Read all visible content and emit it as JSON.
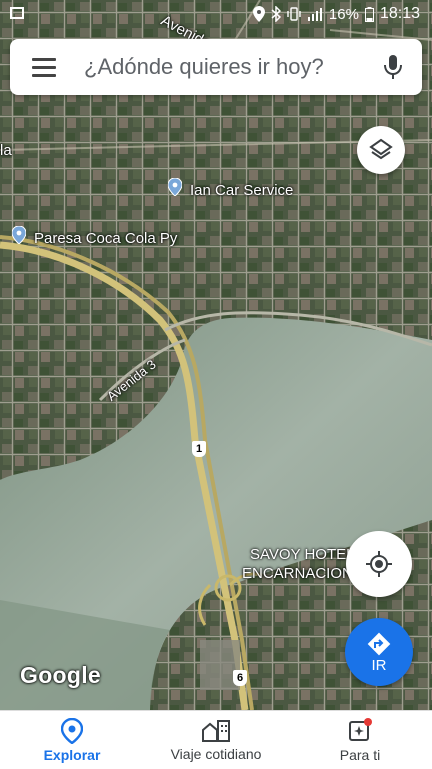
{
  "status": {
    "battery": "16%",
    "time": "18:13"
  },
  "search": {
    "placeholder": "¿Adónde quieres ir hoy?"
  },
  "map": {
    "labels": {
      "avenida_victoria": "Avenida Victor",
      "ian_car": "Ian Car Service",
      "paresa": "Paresa Coca Cola Py",
      "avenida3": "Avenida 3",
      "savoy1": "SAVOY HOTEL",
      "savoy2": "ENCARNACION",
      "la": "la"
    },
    "route_shields": {
      "r1": "1",
      "r6": "6"
    },
    "attribution": "Google"
  },
  "go_button": {
    "label": "IR"
  },
  "nav": {
    "tabs": [
      {
        "label": "Explorar"
      },
      {
        "label": "Viaje cotidiano"
      },
      {
        "label": "Para ti"
      }
    ]
  },
  "colors": {
    "accent": "#1a73e8",
    "water": "#8fa396",
    "road": "#c9b86a"
  }
}
